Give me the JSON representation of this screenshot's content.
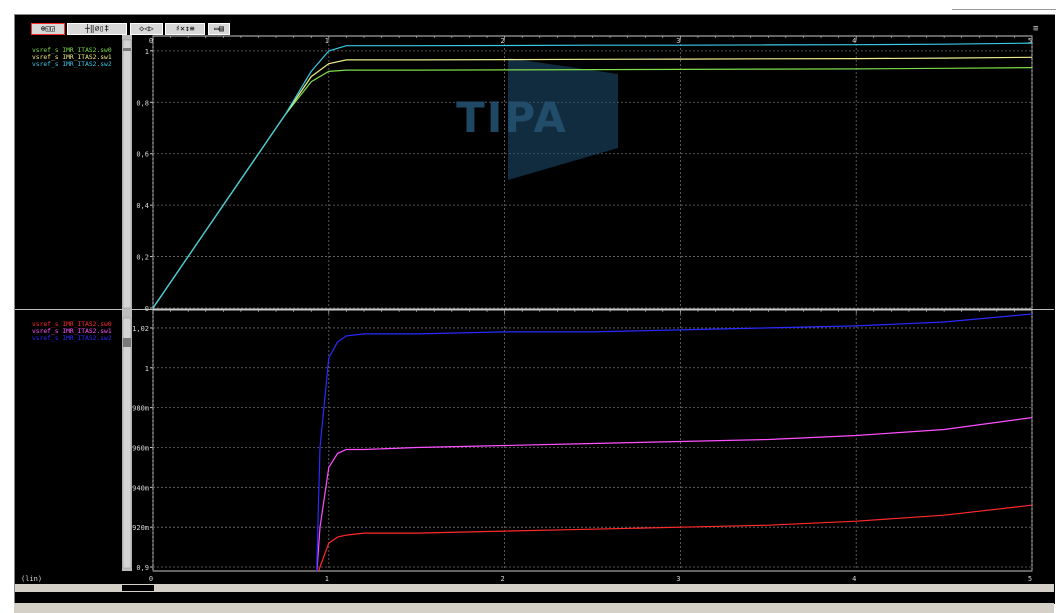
{
  "toolbar": {
    "groups": [
      {
        "name": "zoom-tools",
        "label": "⊕◱◲"
      },
      {
        "name": "cursor-tools",
        "label": "┼‖⌀▯‡"
      },
      {
        "name": "nav-tools",
        "label": "◇◁▷"
      },
      {
        "name": "measure-tools",
        "label": "♯✕↕≡"
      },
      {
        "name": "window-tools",
        "label": "▭▤"
      }
    ],
    "menu_icon": "≡"
  },
  "watermark": "TIPA",
  "x_scale_label": "(lin)",
  "colors": {
    "background": "#000000",
    "grid": "#6e6e6e",
    "frame": "#c8c8c8",
    "tick_text": "#d9d9d9"
  },
  "chart_data": [
    {
      "type": "line",
      "panel": "top",
      "x": [
        0,
        0.25,
        0.5,
        0.75,
        0.9,
        1.0,
        1.1,
        1.2,
        1.5,
        2,
        2.5,
        3,
        3.5,
        4,
        4.5,
        5
      ],
      "series": [
        {
          "name": "vsref_s IMR_ITAS2.sw0",
          "color": "#7ddc4a",
          "values": [
            0,
            0.25,
            0.5,
            0.75,
            0.88,
            0.92,
            0.925,
            0.925,
            0.925,
            0.926,
            0.927,
            0.928,
            0.929,
            0.93,
            0.932,
            0.935
          ]
        },
        {
          "name": "vsref_s IMR_ITAS2.sw1",
          "color": "#ecec8a",
          "values": [
            0,
            0.25,
            0.5,
            0.75,
            0.9,
            0.95,
            0.965,
            0.965,
            0.965,
            0.966,
            0.967,
            0.968,
            0.969,
            0.97,
            0.972,
            0.975
          ]
        },
        {
          "name": "vsref_s IMR_ITAS2.sw2",
          "color": "#39c8e6",
          "values": [
            0,
            0.25,
            0.5,
            0.75,
            0.92,
            1.0,
            1.02,
            1.02,
            1.02,
            1.021,
            1.022,
            1.022,
            1.023,
            1.024,
            1.026,
            1.03
          ]
        }
      ],
      "xlim": [
        0,
        5
      ],
      "ylim": [
        0,
        1.05
      ],
      "yticks": [
        0,
        0.2,
        0.4,
        0.6,
        0.8,
        1
      ],
      "ytick_labels": [
        "0",
        "0,2",
        "0,4",
        "0,6",
        "0,8",
        "1"
      ],
      "xticks": [
        0,
        1,
        2,
        3,
        4,
        5
      ],
      "xtick_labels": [
        "0",
        "1",
        "2",
        "3",
        "4",
        "5"
      ],
      "grid": true,
      "legend": "top-left"
    },
    {
      "type": "line",
      "panel": "bottom",
      "x": [
        0.93,
        0.95,
        1.0,
        1.05,
        1.1,
        1.2,
        1.5,
        2,
        2.5,
        3,
        3.5,
        4,
        4.5,
        5
      ],
      "series": [
        {
          "name": "vsref_s IMR_ITAS2.sw0",
          "color": "#ff2a2a",
          "values": [
            0.895,
            0.9,
            0.912,
            0.915,
            0.916,
            0.917,
            0.917,
            0.918,
            0.919,
            0.92,
            0.921,
            0.923,
            0.926,
            0.931
          ]
        },
        {
          "name": "vsref_s IMR_ITAS2.sw1",
          "color": "#ff50ff",
          "values": [
            0.895,
            0.92,
            0.95,
            0.957,
            0.959,
            0.959,
            0.96,
            0.961,
            0.962,
            0.963,
            0.964,
            0.966,
            0.969,
            0.975
          ]
        },
        {
          "name": "vsref_s IMR_ITAS2.sw2",
          "color": "#2a2aff",
          "values": [
            0.895,
            0.96,
            1.005,
            1.013,
            1.016,
            1.017,
            1.017,
            1.018,
            1.018,
            1.019,
            1.02,
            1.021,
            1.023,
            1.027
          ]
        }
      ],
      "xlim": [
        0,
        5
      ],
      "ylim": [
        0.899,
        1.028
      ],
      "yticks": [
        0.9,
        0.92,
        0.94,
        0.96,
        0.98,
        1,
        1.02
      ],
      "ytick_labels": [
        "0,9",
        "920m",
        "940m",
        "960m",
        "980m",
        "1",
        "1,02"
      ],
      "xticks": [
        0,
        1,
        2,
        3,
        4,
        5
      ],
      "xtick_labels": [
        "0",
        "1",
        "2",
        "3",
        "4",
        "5"
      ],
      "grid": true,
      "legend": "top-left"
    }
  ]
}
